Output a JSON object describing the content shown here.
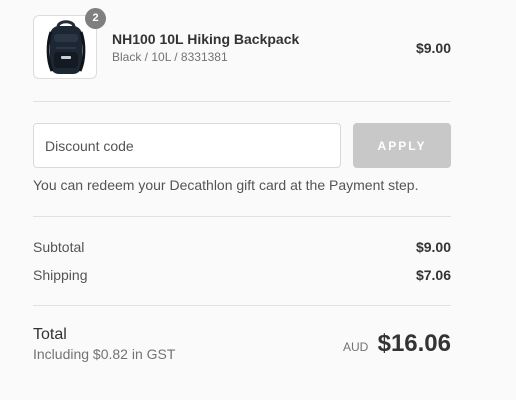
{
  "order_summary": {
    "product": {
      "quantity": "2",
      "name": "NH100 10L Hiking Backpack",
      "variant": "Black / 10L / 8331381",
      "price": "$9.00",
      "image_icon": "backpack-icon"
    },
    "discount": {
      "placeholder": "Discount code",
      "value": "",
      "apply_label": "APPLY"
    },
    "gift_card_note": "You can redeem your Decathlon gift card at the Payment step.",
    "lines": [
      {
        "label": "Subtotal",
        "value": "$9.00"
      },
      {
        "label": "Shipping",
        "value": "$7.06"
      }
    ],
    "total": {
      "label": "Total",
      "tax_note": "Including $0.82 in GST",
      "currency": "AUD",
      "amount": "$16.06"
    }
  },
  "colors": {
    "background": "#fafafa",
    "text": "#333333",
    "muted_text": "#737373",
    "badge": "#7f7f7f",
    "apply_button_disabled": "#c8c8c8",
    "divider": "#e1e1e1"
  }
}
